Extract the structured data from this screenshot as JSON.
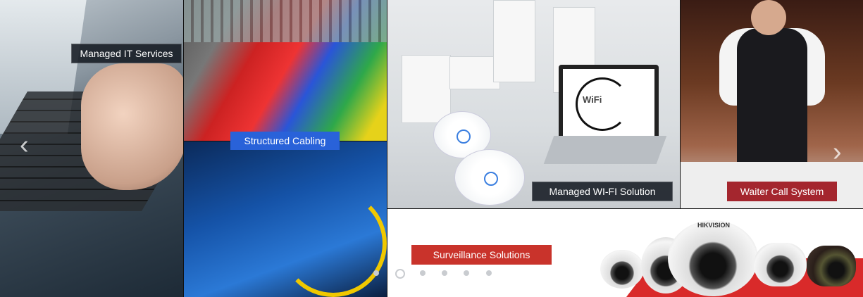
{
  "tiles": {
    "it_services": {
      "label": "Managed IT Services"
    },
    "cabling": {
      "label": "Structured Cabling"
    },
    "wifi": {
      "label": "Managed WI-FI Solution",
      "screen_text": "WiFi"
    },
    "waiter": {
      "label": "Waiter Call System"
    },
    "surveillance": {
      "label": "Surveillance Solutions",
      "brand": "HIKVISION"
    }
  },
  "slider": {
    "prev_arrow": "‹",
    "next_arrow": "‹",
    "dots": [
      {
        "active": true
      },
      {
        "active": false
      },
      {
        "active": false
      },
      {
        "active": false
      },
      {
        "active": false
      },
      {
        "active": false
      }
    ]
  },
  "colors": {
    "label_blue": "#2962d9",
    "label_red": "#c9332b",
    "label_maroon": "#a4262e",
    "accent_red": "#d92a2a"
  }
}
